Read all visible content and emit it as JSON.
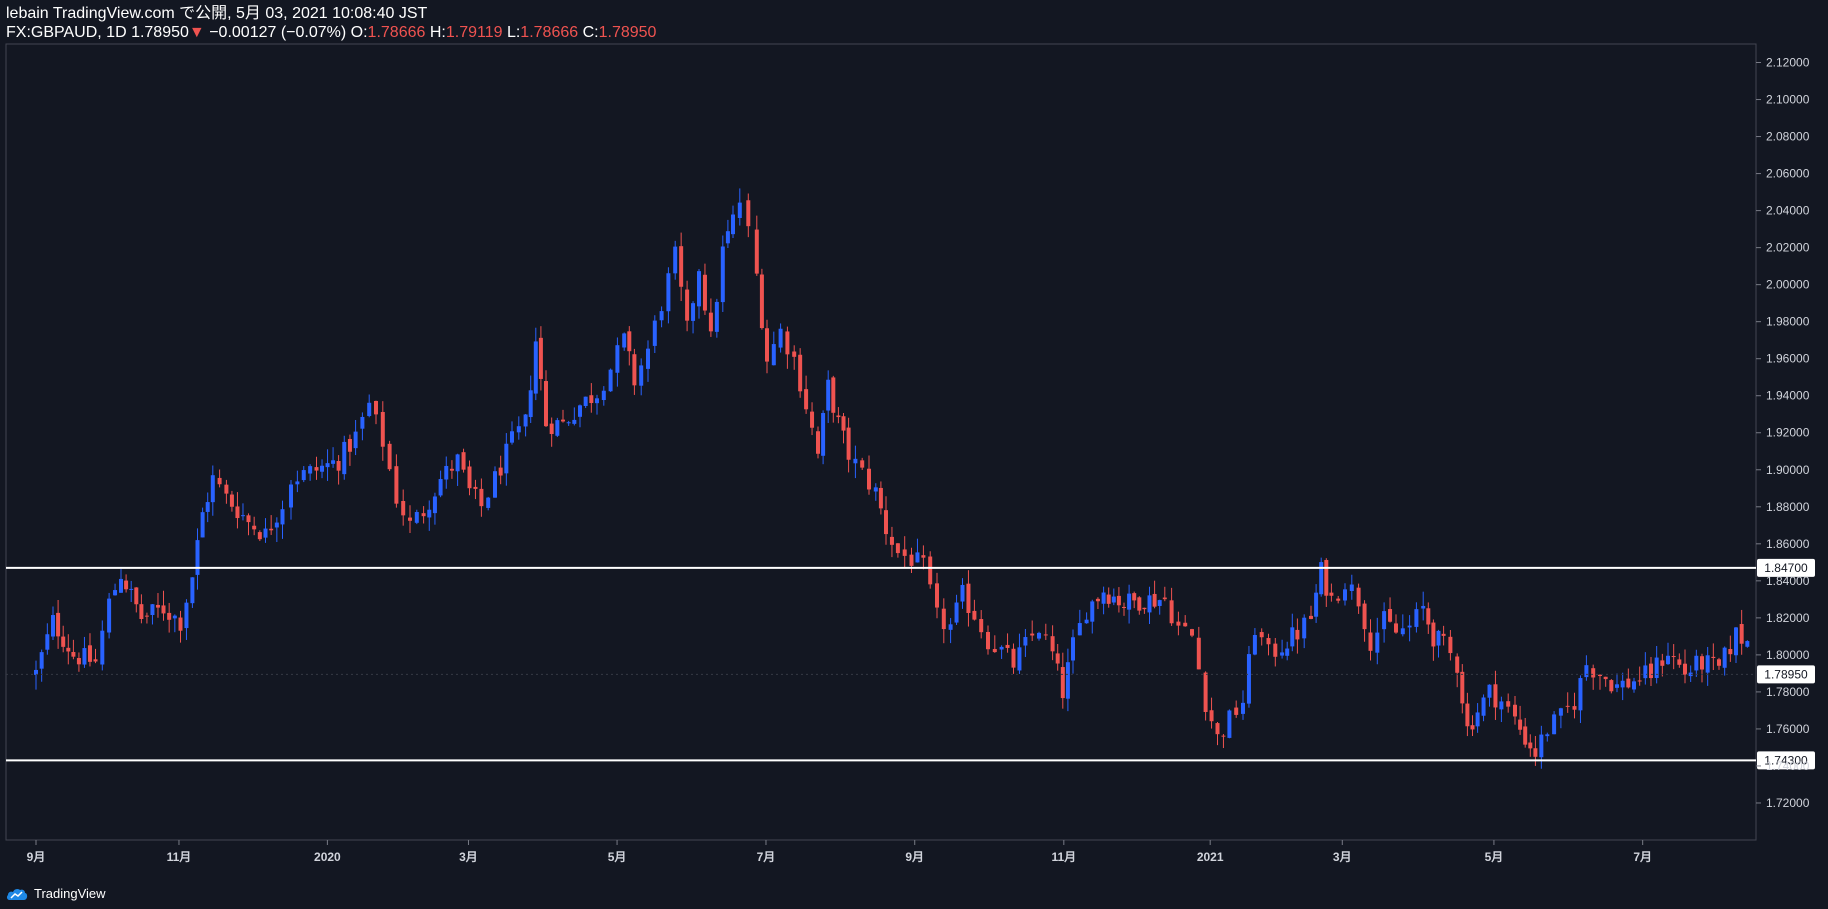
{
  "header": {
    "line1": "lebain TradingView.com で公開, 5月 03, 2021 10:08:40 JST",
    "symbol": "FX:GBPAUD, 1D 1.78950",
    "change": "−0.00127 (−0.07%)",
    "o_label": "O:",
    "o_value": "1.78666",
    "h_label": "H:",
    "h_value": "1.79119",
    "l_label": "L:",
    "l_value": "1.78666",
    "c_label": "C:",
    "c_value": "1.78950"
  },
  "footer": {
    "brand": "TradingView"
  },
  "colors": {
    "up": "#2962ff",
    "down": "#ef5350",
    "background": "#131722",
    "line": "#ffffff"
  },
  "chart_data": {
    "type": "candlestick",
    "symbol": "FX:GBPAUD",
    "interval": "1D",
    "ylim": [
      1.7,
      2.13
    ],
    "y_ticks": [
      "2.12000",
      "2.10000",
      "2.08000",
      "2.06000",
      "2.04000",
      "2.02000",
      "2.00000",
      "1.98000",
      "1.96000",
      "1.94000",
      "1.92000",
      "1.90000",
      "1.88000",
      "1.86000",
      "1.84000",
      "1.82000",
      "1.80000",
      "1.78000",
      "1.76000",
      "1.74000",
      "1.72000"
    ],
    "x_ticks": [
      {
        "label": "9月",
        "frac": 0.0
      },
      {
        "label": "11月",
        "frac": 0.0841
      },
      {
        "label": "2020",
        "frac": 0.1714
      },
      {
        "label": "3月",
        "frac": 0.2544
      },
      {
        "label": "5月",
        "frac": 0.3418
      },
      {
        "label": "7月",
        "frac": 0.4294
      },
      {
        "label": "9月",
        "frac": 0.5169
      },
      {
        "label": "11月",
        "frac": 0.6046
      },
      {
        "label": "2021",
        "frac": 0.6907
      },
      {
        "label": "3月",
        "frac": 0.7684
      },
      {
        "label": "5月",
        "frac": 0.8576
      },
      {
        "label": "7月",
        "frac": 0.9451
      }
    ],
    "horizontal_lines": [
      {
        "value": 1.847,
        "label": "1.84700"
      },
      {
        "value": 1.743,
        "label": "1.74300"
      }
    ],
    "last_price": {
      "value": 1.7895,
      "label": "1.78950"
    },
    "close_path": [
      [
        0.0,
        1.79
      ],
      [
        0.01,
        1.818
      ],
      [
        0.022,
        1.8
      ],
      [
        0.035,
        1.796
      ],
      [
        0.043,
        1.828
      ],
      [
        0.05,
        1.844
      ],
      [
        0.062,
        1.82
      ],
      [
        0.075,
        1.825
      ],
      [
        0.085,
        1.818
      ],
      [
        0.092,
        1.843
      ],
      [
        0.098,
        1.876
      ],
      [
        0.104,
        1.895
      ],
      [
        0.112,
        1.885
      ],
      [
        0.125,
        1.872
      ],
      [
        0.135,
        1.865
      ],
      [
        0.145,
        1.882
      ],
      [
        0.15,
        1.895
      ],
      [
        0.165,
        1.9
      ],
      [
        0.178,
        1.905
      ],
      [
        0.188,
        1.918
      ],
      [
        0.196,
        1.935
      ],
      [
        0.204,
        1.915
      ],
      [
        0.212,
        1.885
      ],
      [
        0.22,
        1.87
      ],
      [
        0.228,
        1.878
      ],
      [
        0.238,
        1.895
      ],
      [
        0.248,
        1.905
      ],
      [
        0.255,
        1.888
      ],
      [
        0.262,
        1.88
      ],
      [
        0.27,
        1.895
      ],
      [
        0.28,
        1.915
      ],
      [
        0.288,
        1.925
      ],
      [
        0.294,
        1.97
      ],
      [
        0.3,
        1.925
      ],
      [
        0.31,
        1.925
      ],
      [
        0.32,
        1.935
      ],
      [
        0.33,
        1.942
      ],
      [
        0.338,
        1.955
      ],
      [
        0.346,
        1.97
      ],
      [
        0.352,
        1.948
      ],
      [
        0.36,
        1.965
      ],
      [
        0.368,
        1.99
      ],
      [
        0.376,
        2.015
      ],
      [
        0.383,
        1.975
      ],
      [
        0.39,
        2.01
      ],
      [
        0.397,
        1.97
      ],
      [
        0.404,
        2.018
      ],
      [
        0.41,
        2.035
      ],
      [
        0.414,
        2.045
      ],
      [
        0.419,
        2.028
      ],
      [
        0.424,
        2.005
      ],
      [
        0.43,
        1.96
      ],
      [
        0.438,
        1.975
      ],
      [
        0.446,
        1.96
      ],
      [
        0.453,
        1.935
      ],
      [
        0.46,
        1.908
      ],
      [
        0.466,
        1.945
      ],
      [
        0.472,
        1.925
      ],
      [
        0.478,
        1.908
      ],
      [
        0.486,
        1.898
      ],
      [
        0.494,
        1.888
      ],
      [
        0.5,
        1.868
      ],
      [
        0.507,
        1.855
      ],
      [
        0.515,
        1.852
      ],
      [
        0.522,
        1.847
      ],
      [
        0.53,
        1.82
      ],
      [
        0.538,
        1.815
      ],
      [
        0.545,
        1.832
      ],
      [
        0.552,
        1.822
      ],
      [
        0.56,
        1.808
      ],
      [
        0.568,
        1.802
      ],
      [
        0.575,
        1.795
      ],
      [
        0.582,
        1.805
      ],
      [
        0.59,
        1.815
      ],
      [
        0.598,
        1.8
      ],
      [
        0.604,
        1.78
      ],
      [
        0.61,
        1.805
      ],
      [
        0.618,
        1.825
      ],
      [
        0.628,
        1.835
      ],
      [
        0.64,
        1.828
      ],
      [
        0.652,
        1.83
      ],
      [
        0.664,
        1.83
      ],
      [
        0.672,
        1.815
      ],
      [
        0.68,
        1.81
      ],
      [
        0.688,
        1.775
      ],
      [
        0.695,
        1.755
      ],
      [
        0.702,
        1.765
      ],
      [
        0.71,
        1.775
      ],
      [
        0.717,
        1.815
      ],
      [
        0.725,
        1.8
      ],
      [
        0.733,
        1.805
      ],
      [
        0.742,
        1.812
      ],
      [
        0.75,
        1.82
      ],
      [
        0.756,
        1.845
      ],
      [
        0.762,
        1.83
      ],
      [
        0.77,
        1.84
      ],
      [
        0.778,
        1.83
      ],
      [
        0.785,
        1.808
      ],
      [
        0.793,
        1.818
      ],
      [
        0.8,
        1.812
      ],
      [
        0.808,
        1.815
      ],
      [
        0.816,
        1.825
      ],
      [
        0.822,
        1.81
      ],
      [
        0.828,
        1.805
      ],
      [
        0.836,
        1.795
      ],
      [
        0.842,
        1.76
      ],
      [
        0.848,
        1.77
      ],
      [
        0.855,
        1.78
      ],
      [
        0.862,
        1.775
      ],
      [
        0.87,
        1.765
      ],
      [
        0.876,
        1.755
      ],
      [
        0.882,
        1.747
      ],
      [
        0.889,
        1.76
      ],
      [
        0.897,
        1.766
      ],
      [
        0.905,
        1.775
      ],
      [
        0.912,
        1.795
      ],
      [
        0.92,
        1.79
      ],
      [
        0.93,
        1.783
      ],
      [
        0.94,
        1.786
      ],
      [
        0.95,
        1.79
      ],
      [
        0.96,
        1.802
      ],
      [
        0.97,
        1.79
      ],
      [
        0.98,
        1.796
      ],
      [
        0.99,
        1.792
      ],
      [
        1.0,
        1.811
      ],
      [
        1.01,
        1.805
      ],
      [
        1.02,
        1.795
      ],
      [
        1.03,
        1.798
      ],
      [
        1.04,
        1.795
      ],
      [
        1.048,
        1.803
      ],
      [
        1.055,
        1.808
      ],
      [
        1.062,
        1.818
      ],
      [
        1.07,
        1.812
      ],
      [
        1.078,
        1.805
      ],
      [
        1.085,
        1.798
      ],
      [
        1.09,
        1.79
      ],
      [
        1.097,
        1.781
      ],
      [
        1.104,
        1.795
      ],
      [
        1.11,
        1.789
      ]
    ]
  }
}
